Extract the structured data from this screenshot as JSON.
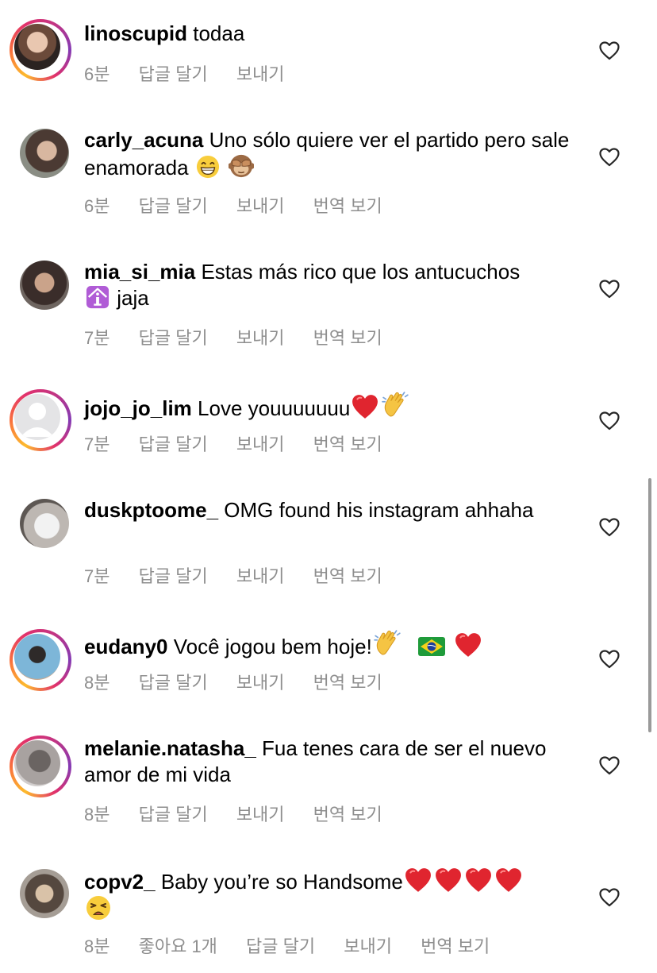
{
  "comments": [
    {
      "username": "linoscupid",
      "text": "todaa",
      "time": "6분",
      "reply": "답글 달기",
      "send": "보내기"
    },
    {
      "username": "carly_acuna",
      "text": "Uno sólo quiere ver el partido pero sale enamorada",
      "emojis": [
        "grinning-face-emoji",
        "see-no-evil-monkey-emoji"
      ],
      "time": "6분",
      "reply": "답글 달기",
      "send": "보내기",
      "translate": "번역 보기"
    },
    {
      "username": "mia_si_mia",
      "text": "Estas más rico que los antucuchos",
      "text2": "jaja",
      "emojis": [
        "info-symbol-emoji"
      ],
      "time": "7분",
      "reply": "답글 달기",
      "send": "보내기",
      "translate": "번역 보기"
    },
    {
      "username": "jojo_jo_lim",
      "text": "Love youuuuuuu",
      "emojis": [
        "red-heart-emoji",
        "clapping-hands-emoji"
      ],
      "time": "7분",
      "reply": "답글 달기",
      "send": "보내기",
      "translate": "번역 보기"
    },
    {
      "username": "duskptoome_",
      "text": "OMG found his instagram ahhaha",
      "time": "7분",
      "reply": "답글 달기",
      "send": "보내기",
      "translate": "번역 보기"
    },
    {
      "username": "eudany0",
      "text": "Você jogou bem hoje!",
      "emojis": [
        "clapping-hands-emoji",
        "brazil-flag-emoji",
        "red-heart-emoji"
      ],
      "time": "8분",
      "reply": "답글 달기",
      "send": "보내기",
      "translate": "번역 보기"
    },
    {
      "username": "melanie.natasha_",
      "text": "Fua tenes cara de ser el nuevo amor de mi vida",
      "time": "8분",
      "reply": "답글 달기",
      "send": "보내기",
      "translate": "번역 보기"
    },
    {
      "username": "copv2_",
      "text": "Baby you’re so Handsome",
      "emojis": [
        "red-heart-emoji",
        "red-heart-emoji",
        "red-heart-emoji",
        "red-heart-emoji",
        "weary-face-emoji"
      ],
      "time": "8분",
      "likes": "좋아요 1개",
      "reply": "답글 달기",
      "send": "보내기",
      "translate": "번역 보기"
    }
  ],
  "colors": {
    "meta": "#8e8e8e",
    "heart": "#262626",
    "story_ring": "#e1306c"
  }
}
